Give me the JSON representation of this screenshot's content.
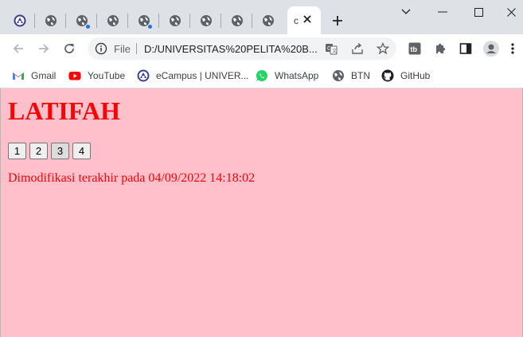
{
  "browser": {
    "tabs": [
      {
        "favicon": "university-icon",
        "notification": false
      },
      {
        "favicon": "globe-icon",
        "notification": false
      },
      {
        "favicon": "globe-icon",
        "notification": true
      },
      {
        "favicon": "globe-icon",
        "notification": false
      },
      {
        "favicon": "globe-icon",
        "notification": true
      },
      {
        "favicon": "globe-icon",
        "notification": false
      },
      {
        "favicon": "globe-icon",
        "notification": false
      },
      {
        "favicon": "globe-icon",
        "notification": false
      },
      {
        "favicon": "globe-icon",
        "notification": false
      }
    ],
    "active_tab": {
      "title_fragment": "c"
    },
    "address_bar": {
      "scheme_label": "File",
      "url": "D:/UNIVERSITAS%20PELITA%20B..."
    },
    "bookmarks": [
      {
        "label": "Gmail",
        "icon": "gmail-icon"
      },
      {
        "label": "YouTube",
        "icon": "youtube-icon"
      },
      {
        "label": "eCampus | UNIVER...",
        "icon": "university-icon"
      },
      {
        "label": "WhatsApp",
        "icon": "whatsapp-icon"
      },
      {
        "label": "BTN",
        "icon": "globe-icon"
      },
      {
        "label": "GitHub",
        "icon": "github-icon"
      }
    ]
  },
  "page": {
    "heading": "LATIFAH",
    "buttons": [
      {
        "label": "1"
      },
      {
        "label": "2"
      },
      {
        "label": "3"
      },
      {
        "label": "4"
      }
    ],
    "last_modified": "Dimodifikasi terakhir pada 04/09/2022 14:18:02"
  },
  "colors": {
    "page_background": "#ffc0cb",
    "page_text": "#ff0000",
    "chrome_frame": "#dee1e6",
    "accent": "#1a73e8"
  }
}
